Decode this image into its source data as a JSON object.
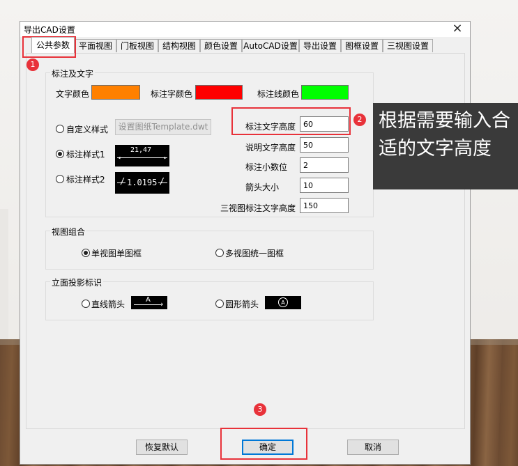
{
  "dialog": {
    "title": "导出CAD设置",
    "close_glyph": "×",
    "tabs": [
      "公共参数",
      "平面视图",
      "门板视图",
      "结构视图",
      "颜色设置",
      "AutoCAD设置",
      "导出设置",
      "图框设置",
      "三视图设置"
    ],
    "active_tab": "公共参数"
  },
  "annotation_text": {
    "group_title": "标注及文字",
    "text_color_label": "文字颜色",
    "dim_text_color_label": "标注字颜色",
    "dim_line_color_label": "标注线颜色",
    "custom_style_label": "自定义样式",
    "template_button": "设置图纸Template.dwt",
    "style1_label": "标注样式1",
    "style2_label": "标注样式2",
    "style1_preview": "21,47",
    "style2_preview": "1.0195",
    "fields": [
      {
        "label": "标注文字高度",
        "value": "60"
      },
      {
        "label": "说明文字高度",
        "value": "50"
      },
      {
        "label": "标注小数位",
        "value": "2"
      },
      {
        "label": "箭头大小",
        "value": "10"
      },
      {
        "label": "三视图标注文字高度",
        "value": "150"
      }
    ]
  },
  "colors": {
    "text_color": "#ff8000",
    "dim_text_color": "#ff0000",
    "dim_line_color": "#00ff00",
    "annotation_red": "#e8323a",
    "callout_bg": "#3a3a3a",
    "primary_border": "#0078d7"
  },
  "view_combo": {
    "group_title": "视图组合",
    "option1": "单视图单图框",
    "option2": "多视图统一图框",
    "selected": "单视图单图框"
  },
  "elevation": {
    "group_title": "立面投影标识",
    "option1": "直线箭头",
    "option2": "圆形箭头",
    "arrow_letter": "A"
  },
  "footer": {
    "reset": "恢复默认",
    "ok": "确定",
    "cancel": "取消"
  },
  "annotations": {
    "badge1": "1",
    "badge2": "2",
    "badge3": "3",
    "callout_text": "根据需要输入合适的文字高度"
  }
}
